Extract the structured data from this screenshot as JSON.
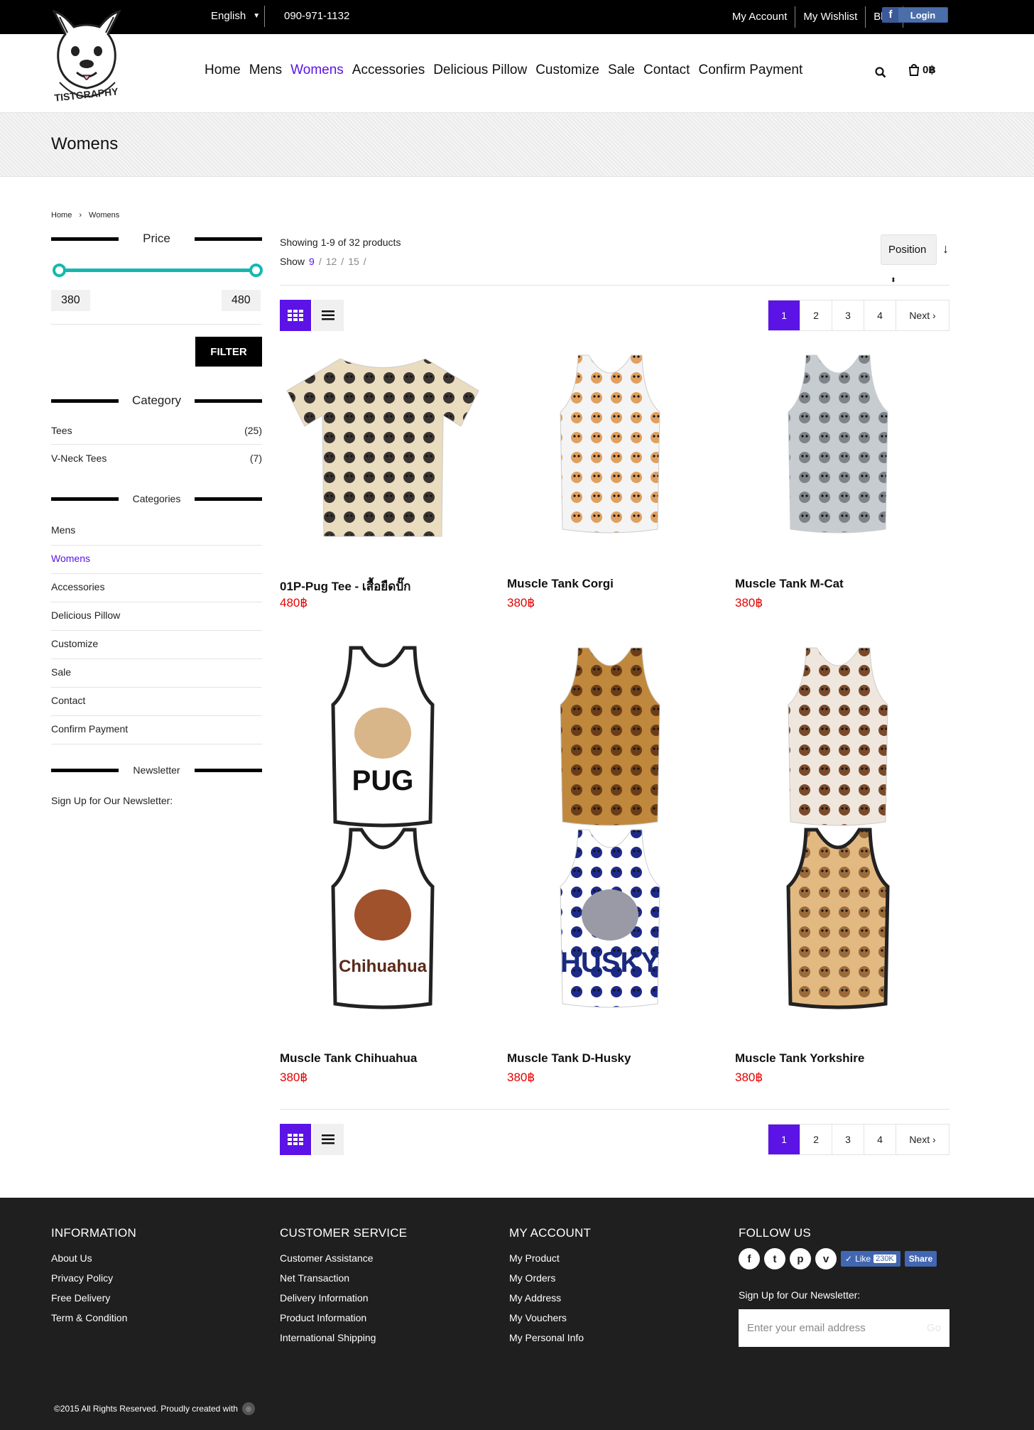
{
  "topbar": {
    "language": "English",
    "phone": "090-971-1132",
    "links": [
      "My Account",
      "My Wishlist",
      "Blog",
      "Log In"
    ],
    "fb_login": "Login"
  },
  "brand": {
    "logo_text": "TISTGRAPHY"
  },
  "nav": {
    "items": [
      "Home",
      "Mens",
      "Womens",
      "Accessories",
      "Delicious Pillow",
      "Customize",
      "Sale",
      "Contact",
      "Confirm Payment"
    ],
    "active": "Womens"
  },
  "cart": {
    "total": "0฿"
  },
  "page": {
    "title": "Womens"
  },
  "breadcrumb": {
    "home": "Home",
    "current": "Womens"
  },
  "sidebar": {
    "price_title": "Price",
    "price_min": "380",
    "price_max": "480",
    "filter_label": "FILTER",
    "category_title": "Category",
    "category": [
      {
        "label": "Tees",
        "count": "(25)"
      },
      {
        "label": "V-Neck Tees",
        "count": "(7)"
      }
    ],
    "categories_title": "Categories",
    "categories": [
      "Mens",
      "Womens",
      "Accessories",
      "Delicious Pillow",
      "Customize",
      "Sale",
      "Contact",
      "Confirm Payment"
    ],
    "categories_active": "Womens",
    "newsletter_title": "Newsletter",
    "newsletter_text": "Sign Up for Our Newsletter:"
  },
  "toolbar": {
    "showing": "Showing 1-9 of 32 products",
    "show_label": "Show",
    "show_options": [
      "9",
      "12",
      "15"
    ],
    "show_active": "9",
    "sort_select": "Position",
    "sort_direction": "↓"
  },
  "pagination": {
    "pages": [
      "1",
      "2",
      "3",
      "4"
    ],
    "active": "1",
    "next": "Next"
  },
  "products": [
    {
      "name": "01P-Pug Tee - เสื้อยืดปั๊ก",
      "price": "480฿",
      "pattern": "pug-pattern-tee"
    },
    {
      "name": "Muscle Tank Corgi",
      "price": "380฿",
      "pattern": "corgi-tank"
    },
    {
      "name": "Muscle Tank M-Cat",
      "price": "380฿",
      "pattern": "cat-tank"
    },
    {
      "name": "",
      "price": "",
      "pattern": "pug-tank",
      "print": "PUG"
    },
    {
      "name": "",
      "price": "",
      "pattern": "chihuahua-pattern-tank"
    },
    {
      "name": "",
      "price": "",
      "pattern": "shihtzu-pattern-tank"
    },
    {
      "name": "Muscle Tank Chihuahua",
      "price": "380฿",
      "pattern": "chihuahua-tank",
      "print": "Chihuahua"
    },
    {
      "name": "Muscle Tank D-Husky",
      "price": "380฿",
      "pattern": "husky-tank",
      "print": "HUSKY"
    },
    {
      "name": "Muscle Tank Yorkshire",
      "price": "380฿",
      "pattern": "yorkshire-tank"
    }
  ],
  "footer": {
    "information": {
      "title": "INFORMATION",
      "links": [
        "About Us",
        "Privacy Policy",
        "Free Delivery",
        "Term & Condition"
      ]
    },
    "customer_service": {
      "title": "CUSTOMER SERVICE",
      "links": [
        "Customer Assistance",
        "Net Transaction",
        "Delivery Information",
        "Product Information",
        "International Shipping"
      ]
    },
    "my_account": {
      "title": "MY ACCOUNT",
      "links": [
        "My Product",
        "My Orders",
        "My Address",
        "My Vouchers",
        "My Personal Info"
      ]
    },
    "follow": {
      "title": "FOLLOW US",
      "icons": [
        "facebook-icon",
        "twitter-icon",
        "pinterest-icon",
        "vimeo-icon"
      ],
      "like_label": "Like",
      "like_count": "230K",
      "share_label": "Share",
      "signup_label": "Sign Up for Our Newsletter:",
      "email_placeholder": "Enter your email address",
      "go_label": "Go"
    },
    "copyright": "©2015 All Rights Reserved. Proudly created with"
  },
  "colors": {
    "accent": "#5b13e6",
    "price": "#e60000",
    "slider": "#14b8b0",
    "footer_bg": "#1f1f1f"
  }
}
